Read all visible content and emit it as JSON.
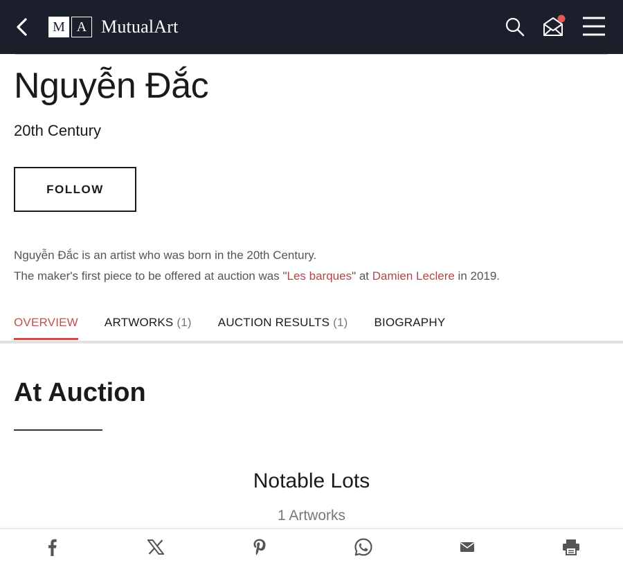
{
  "header": {
    "logo_m": "M",
    "logo_a": "A",
    "brand": "MutualArt",
    "notification_color": "#e05a5a"
  },
  "artist": {
    "name": "Nguyễn Đắc",
    "century": "20th Century",
    "follow_label": "FOLLOW"
  },
  "intro": {
    "line1": "Nguyễn Đắc is an artist who was born in the 20th Century.",
    "line2_prefix": "The maker's first piece to be offered at auction was \"",
    "artwork_link": "Les barques",
    "line2_mid": "\" at ",
    "auction_house_link": "Damien Leclere",
    "line2_suffix": " in 2019."
  },
  "tabs": [
    {
      "label": "OVERVIEW",
      "count": ""
    },
    {
      "label": "ARTWORKS",
      "count": "(1)"
    },
    {
      "label": "AUCTION RESULTS",
      "count": "(1)"
    },
    {
      "label": "BIOGRAPHY",
      "count": ""
    }
  ],
  "section": {
    "title": "At Auction",
    "notable_title": "Notable Lots",
    "notable_sub": "1 Artworks"
  },
  "share": [
    "facebook-icon",
    "x-icon",
    "pinterest-icon",
    "whatsapp-icon",
    "email-icon",
    "print-icon"
  ],
  "colors": {
    "nav_bg": "#1b1f2b",
    "accent": "#c0504d"
  }
}
